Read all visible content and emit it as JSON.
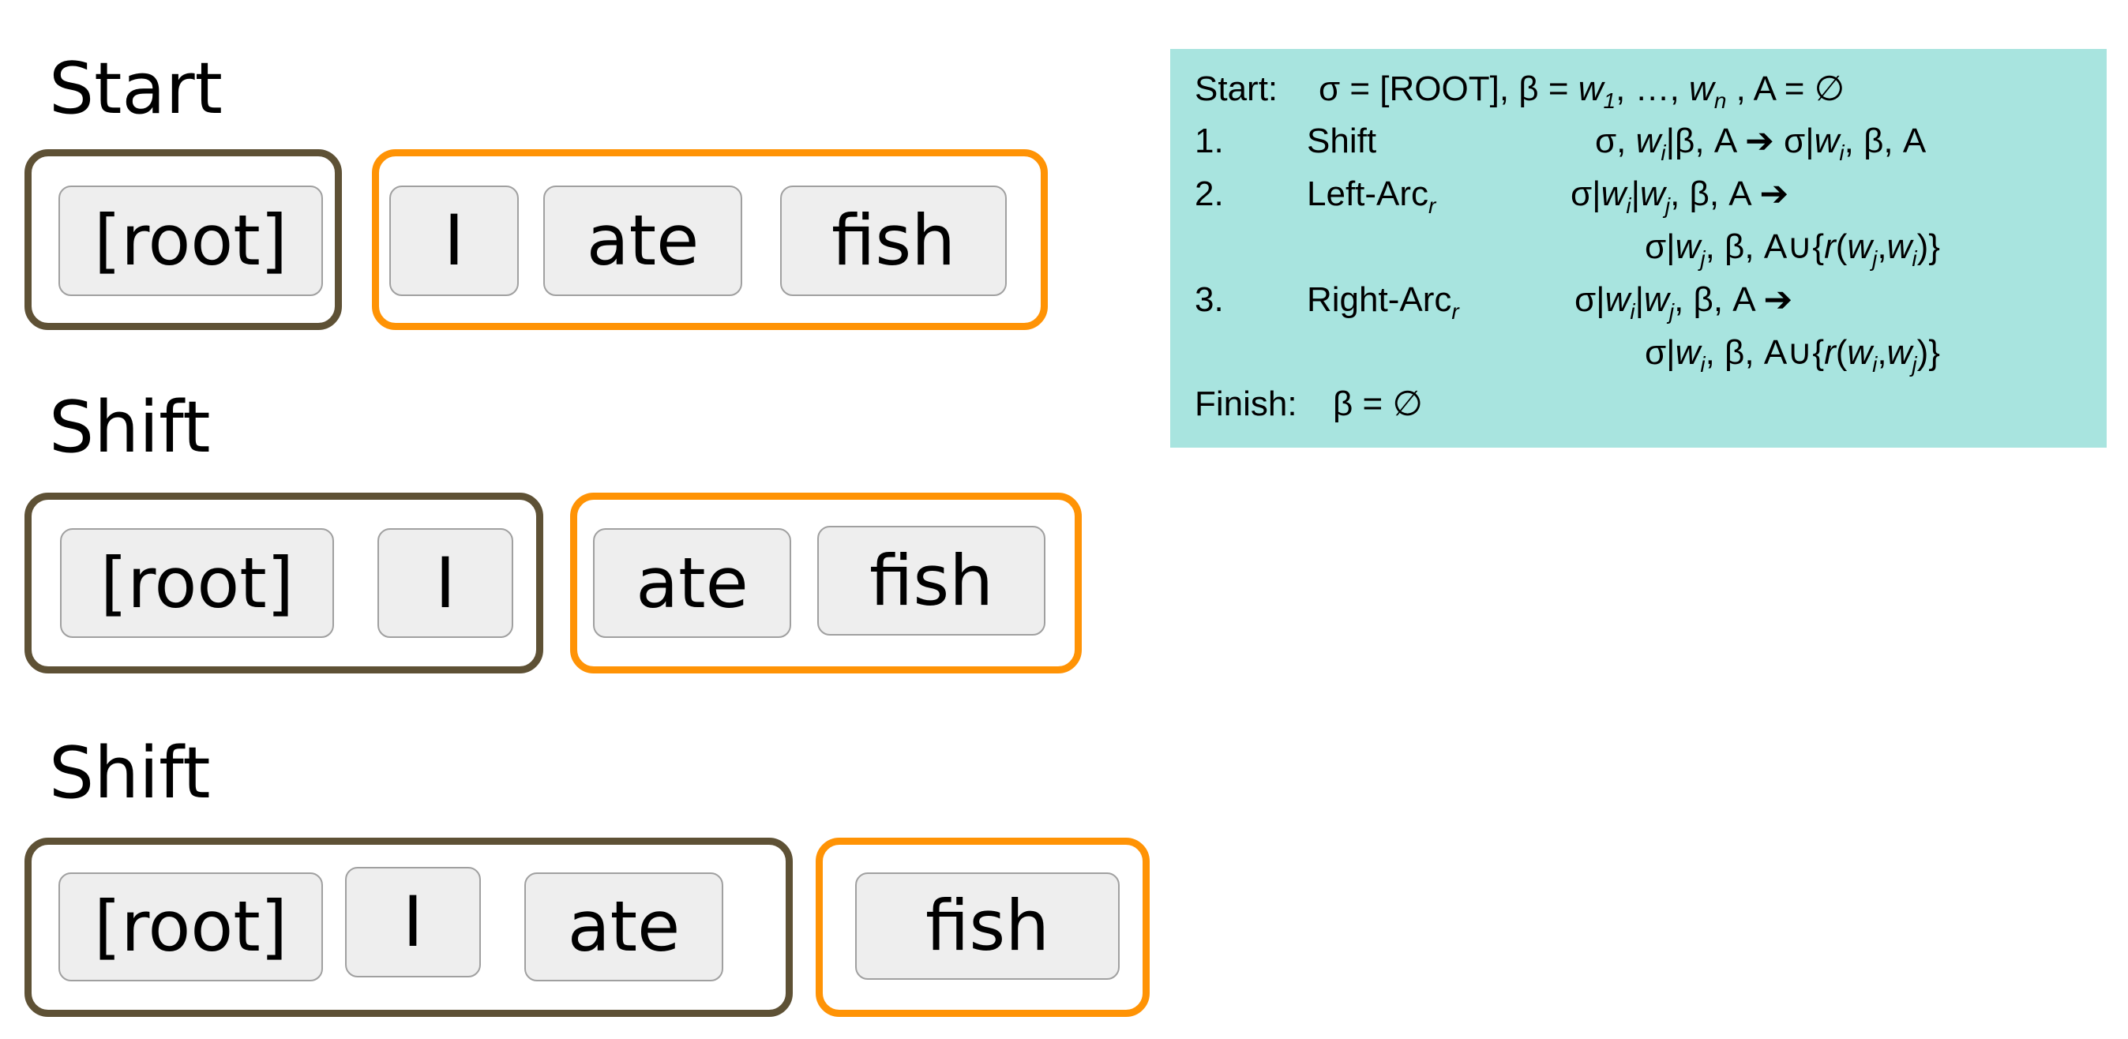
{
  "steps": [
    {
      "title": "Start",
      "stack": [
        "[root]"
      ],
      "buffer": [
        "I",
        "ate",
        "fish"
      ]
    },
    {
      "title": "Shift",
      "stack": [
        "[root]",
        "I"
      ],
      "buffer": [
        "ate",
        "fish"
      ]
    },
    {
      "title": "Shift",
      "stack": [
        "[root]",
        "I",
        "ate"
      ],
      "buffer": [
        "fish"
      ]
    }
  ],
  "colors": {
    "stack_border": "#5e5135",
    "buffer_border": "#ff9305",
    "token_fill": "#eeeeee",
    "rules_bg": "#a8e4df"
  },
  "rules": {
    "start_label": "Start:",
    "start": [
      {
        "t": "σ = [ROOT], β = "
      },
      {
        "t": "w",
        "i": 1
      },
      {
        "sub": "1"
      },
      {
        "t": ", …, "
      },
      {
        "t": "w",
        "i": 1
      },
      {
        "sub": "n"
      },
      {
        "t": " , A = ∅"
      }
    ],
    "items": [
      {
        "num": "1.",
        "name": "Shift",
        "name_sub": "",
        "lhs": [
          {
            "t": "σ, "
          },
          {
            "t": "w",
            "i": 1
          },
          {
            "sub": "i"
          },
          {
            "t": "|β, A ➔ σ|"
          },
          {
            "t": "w",
            "i": 1
          },
          {
            "sub": "i"
          },
          {
            "t": ", β, A"
          }
        ],
        "rhs": []
      },
      {
        "num": "2.",
        "name": "Left-Arc",
        "name_sub": "r",
        "lhs": [
          {
            "t": "σ|"
          },
          {
            "t": "w",
            "i": 1
          },
          {
            "sub": "i"
          },
          {
            "t": "|"
          },
          {
            "t": "w",
            "i": 1
          },
          {
            "sub": "j"
          },
          {
            "t": ", β, A ➔"
          }
        ],
        "rhs": [
          {
            "t": "σ|"
          },
          {
            "t": "w",
            "i": 1
          },
          {
            "sub": "j"
          },
          {
            "t": ", β, A∪{"
          },
          {
            "t": "r",
            "i": 1
          },
          {
            "t": "("
          },
          {
            "t": "w",
            "i": 1
          },
          {
            "sub": "j"
          },
          {
            "t": ","
          },
          {
            "t": "w",
            "i": 1
          },
          {
            "sub": "i"
          },
          {
            "t": ")}"
          }
        ]
      },
      {
        "num": "3.",
        "name": "Right-Arc",
        "name_sub": "r",
        "lhs": [
          {
            "t": "σ|"
          },
          {
            "t": "w",
            "i": 1
          },
          {
            "sub": "i"
          },
          {
            "t": "|"
          },
          {
            "t": "w",
            "i": 1
          },
          {
            "sub": "j"
          },
          {
            "t": ", β, A ➔"
          }
        ],
        "rhs": [
          {
            "t": "σ|"
          },
          {
            "t": "w",
            "i": 1
          },
          {
            "sub": "i"
          },
          {
            "t": ", β, A∪{"
          },
          {
            "t": "r",
            "i": 1
          },
          {
            "t": "("
          },
          {
            "t": "w",
            "i": 1
          },
          {
            "sub": "i"
          },
          {
            "t": ","
          },
          {
            "t": "w",
            "i": 1
          },
          {
            "sub": "j"
          },
          {
            "t": ")}"
          }
        ]
      }
    ],
    "finish_label": "Finish:",
    "finish": [
      {
        "t": "β = ∅"
      }
    ]
  }
}
